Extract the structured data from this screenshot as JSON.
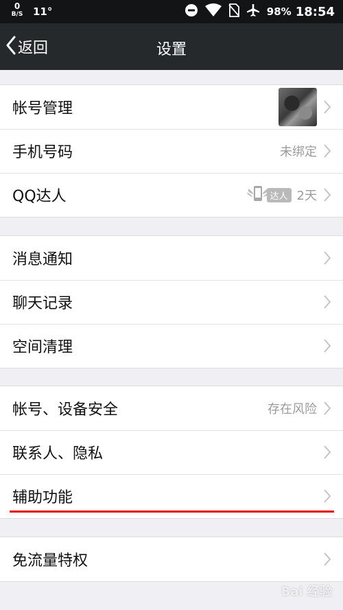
{
  "status_bar": {
    "net_speed_value": "0",
    "net_speed_unit": "B/S",
    "temperature": "11°",
    "icons": [
      "dnd-icon",
      "wifi-icon",
      "no-sim-icon",
      "airplane-icon"
    ],
    "battery": "98%",
    "time": "18:54"
  },
  "nav": {
    "back_label": "返回",
    "title": "设置"
  },
  "groups": [
    {
      "rows": [
        {
          "label": "帐号管理",
          "value": ""
        },
        {
          "label": "手机号码",
          "value": "未绑定"
        },
        {
          "label": "QQ达人",
          "badge": "达人",
          "value": "2天"
        }
      ]
    },
    {
      "rows": [
        {
          "label": "消息通知",
          "value": ""
        },
        {
          "label": "聊天记录",
          "value": ""
        },
        {
          "label": "空间清理",
          "value": ""
        }
      ]
    },
    {
      "rows": [
        {
          "label": "帐号、设备安全",
          "value": "存在风险"
        },
        {
          "label": "联系人、隐私",
          "value": ""
        },
        {
          "label": "辅助功能",
          "value": ""
        }
      ]
    },
    {
      "rows": [
        {
          "label": "免流量特权",
          "value": ""
        }
      ]
    }
  ],
  "annotation_color": "#e30000",
  "watermark": "Bai 经验"
}
